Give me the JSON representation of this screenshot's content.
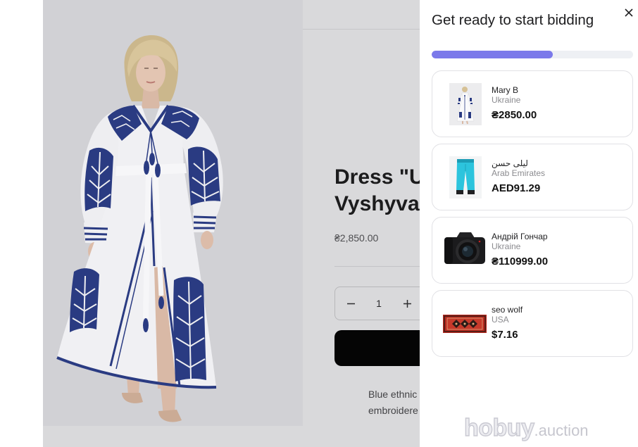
{
  "product": {
    "title_lines": [
      "Dress \"U",
      "Vyshyva"
    ],
    "price": "₴2,850.00",
    "quantity": "1",
    "description_lines": [
      "Blue ethnic",
      "embroidere"
    ]
  },
  "panel": {
    "title": "Get ready to start bidding",
    "progress": 0.6,
    "bids": [
      {
        "name": "Mary B",
        "country": "Ukraine",
        "price": "₴2850.00"
      },
      {
        "name": "ليلى حسن",
        "country": "Arab Emirates",
        "price": "AED91.29"
      },
      {
        "name": "Андрій Гончар",
        "country": "Ukraine",
        "price": "₴110999.00"
      },
      {
        "name": "seo wolf",
        "country": "USA",
        "price": "$7.16"
      }
    ]
  },
  "logo": {
    "brand": "hobuy",
    "suffix": ".auction"
  },
  "icons": {
    "close": "close-icon",
    "decrement": "minus-icon",
    "increment": "plus-icon"
  },
  "colors": {
    "accent": "#7b79ea",
    "button": "#050505"
  }
}
